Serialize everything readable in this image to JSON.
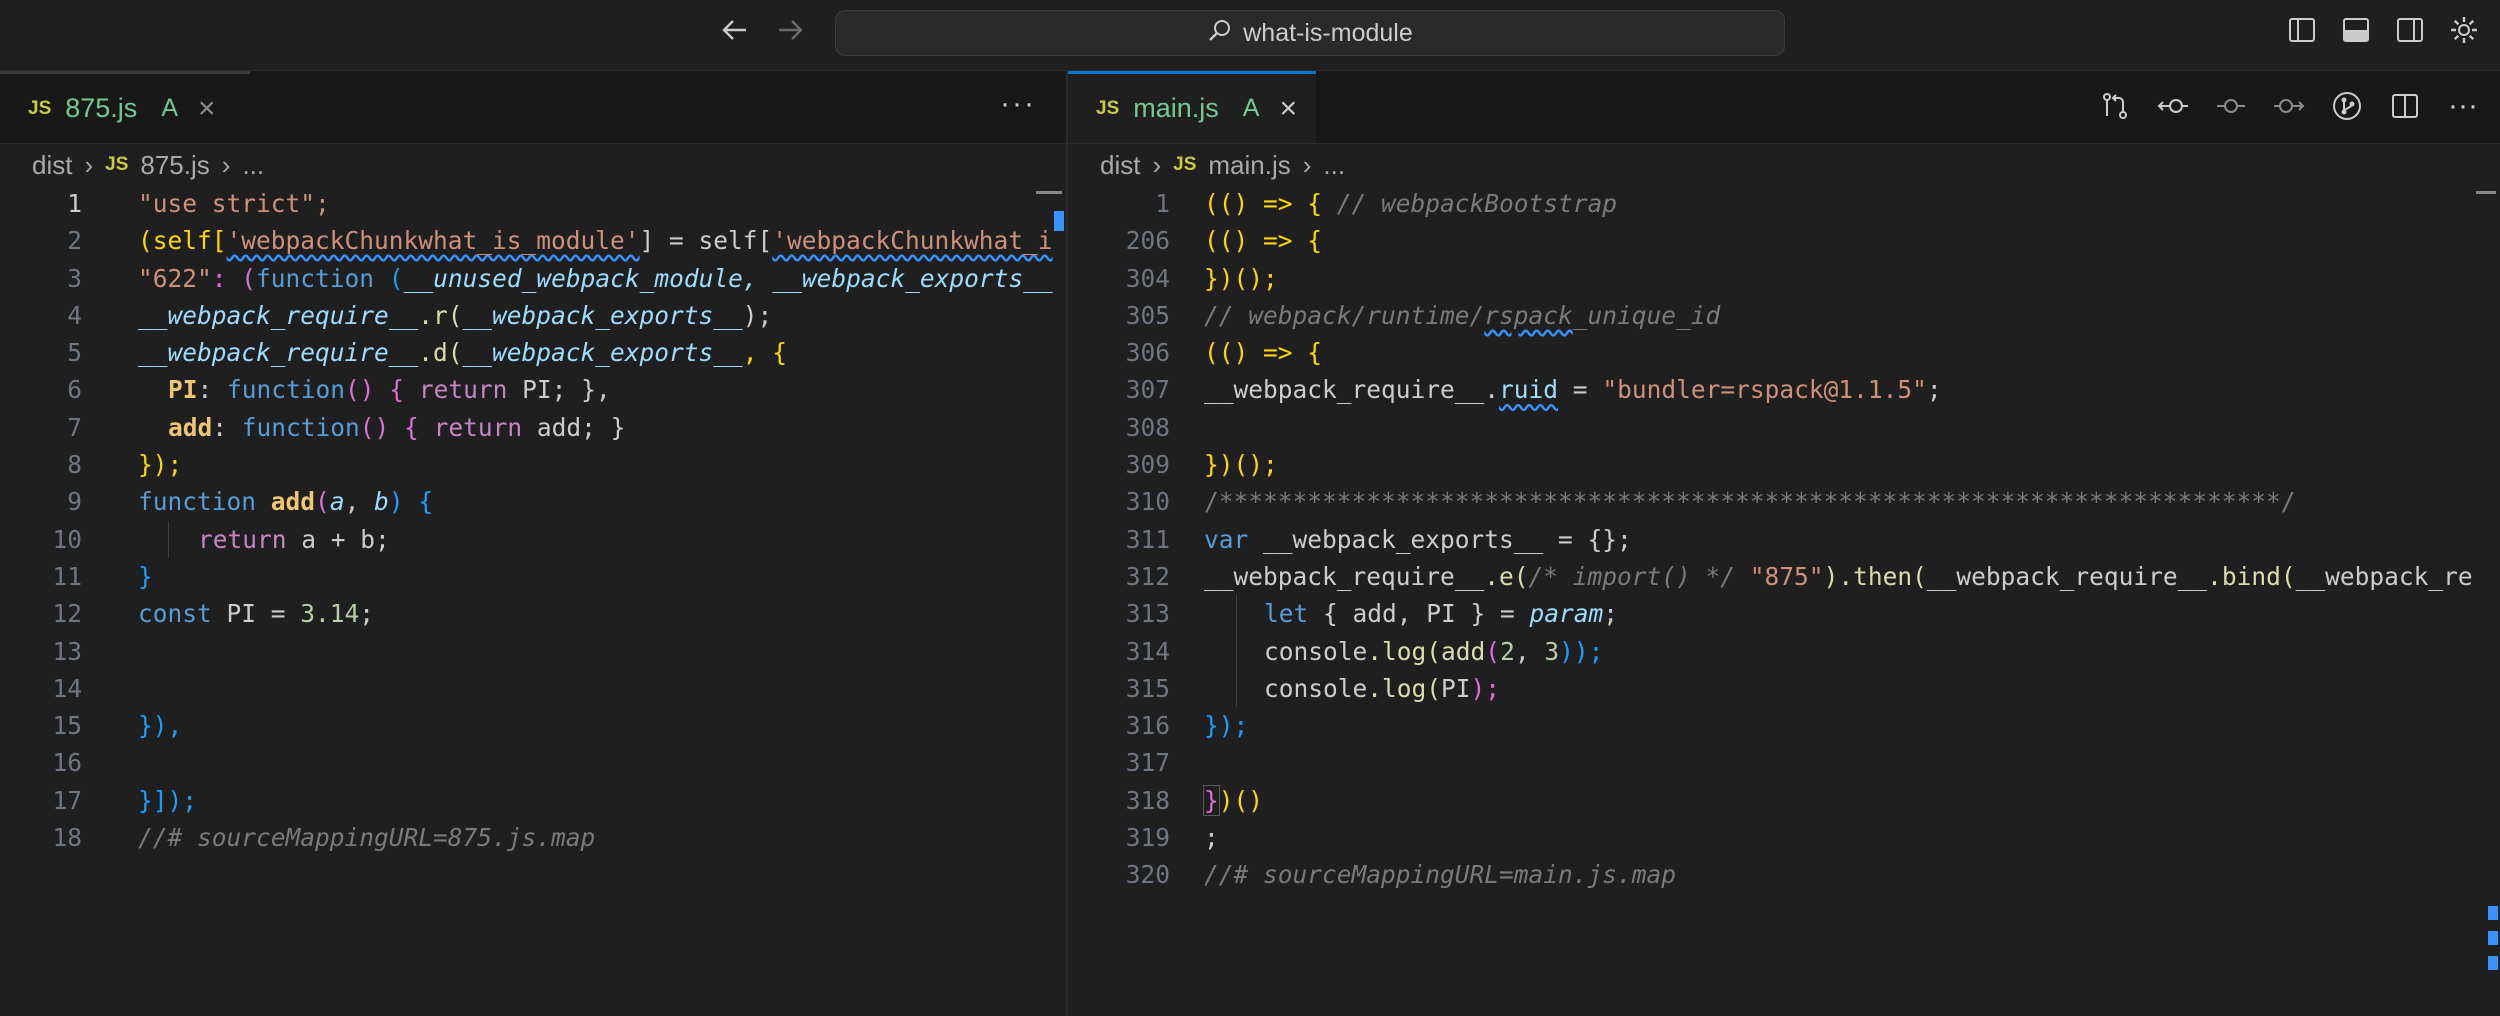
{
  "titlebar": {
    "search_label": "what-is-module",
    "back_icon": "arrow-left-icon",
    "forward_icon": "arrow-right-icon",
    "layout_icons": [
      "toggle-primary-sidebar-icon",
      "toggle-panel-icon",
      "toggle-secondary-sidebar-icon",
      "settings-gear-icon"
    ]
  },
  "left_pane": {
    "tab": {
      "badge": "JS",
      "name": "875.js",
      "status": "A",
      "close": "×"
    },
    "more": "···",
    "breadcrumb": {
      "folder": "dist",
      "badge": "JS",
      "file": "875.js",
      "ellipsis": "..."
    },
    "lines": [
      {
        "n": "1"
      },
      {
        "n": "2"
      },
      {
        "n": "3"
      },
      {
        "n": "4"
      },
      {
        "n": "5"
      },
      {
        "n": "6"
      },
      {
        "n": "7"
      },
      {
        "n": "8"
      },
      {
        "n": "9"
      },
      {
        "n": "10"
      },
      {
        "n": "11"
      },
      {
        "n": "12"
      },
      {
        "n": "13"
      },
      {
        "n": "14"
      },
      {
        "n": "15"
      },
      {
        "n": "16"
      },
      {
        "n": "17"
      },
      {
        "n": "18"
      }
    ],
    "code": {
      "l1": "\"use strict\";",
      "l2a": "(self[",
      "l2b": "'webpackChunkwhat_is_module'",
      "l2c": "] = self[",
      "l2d": "'webpackChunkwhat_i",
      "l3a": "\"622\"",
      "l3b": ": (",
      "l3c": "function",
      "l3d": " (",
      "l3e": "__unused_webpack_module, __webpack_exports__",
      "l4a": "__webpack_require__",
      "l4b": ".r(",
      "l4c": "__webpack_exports__",
      "l4d": ");",
      "l5a": "__webpack_require__",
      "l5b": ".d(",
      "l5c": "__webpack_exports__",
      "l5d": ", {",
      "l6a": "PI",
      "l6b": ": ",
      "l6c": "function",
      "l6d": "() { ",
      "l6e": "return",
      "l6f": " PI; },",
      "l7a": "add",
      "l7b": ": ",
      "l7c": "function",
      "l7d": "() { ",
      "l7e": "return",
      "l7f": " add; }",
      "l8": "});",
      "l9a": "function",
      "l9b": "add",
      "l9c": "(",
      "l9d": "a",
      "l9e": ", ",
      "l9f": "b",
      "l9g": ") {",
      "l10a": "return",
      "l10b": " a + b;",
      "l11": "}",
      "l12a": "const",
      "l12b": " PI = ",
      "l12c": "3.14",
      "l12d": ";",
      "l15": "}),",
      "l17": "}]);",
      "l18": "//# sourceMappingURL=875.js.map"
    }
  },
  "right_pane": {
    "tab": {
      "badge": "JS",
      "name": "main.js",
      "status": "A",
      "close": "×"
    },
    "more": "···",
    "actions": [
      "compare-changes-icon",
      "go-previous-change-icon",
      "go-to-change-icon",
      "go-next-change-icon",
      "open-timeline-icon",
      "split-editor-icon"
    ],
    "breadcrumb": {
      "folder": "dist",
      "badge": "JS",
      "file": "main.js",
      "ellipsis": "..."
    },
    "lines": [
      {
        "n": "1"
      },
      {
        "n": "206"
      },
      {
        "n": "304"
      },
      {
        "n": "305"
      },
      {
        "n": "306"
      },
      {
        "n": "307"
      },
      {
        "n": "308"
      },
      {
        "n": "309"
      },
      {
        "n": "310"
      },
      {
        "n": "311"
      },
      {
        "n": "312"
      },
      {
        "n": "313"
      },
      {
        "n": "314"
      },
      {
        "n": "315"
      },
      {
        "n": "316"
      },
      {
        "n": "317"
      },
      {
        "n": "318"
      },
      {
        "n": "319"
      },
      {
        "n": "320"
      }
    ],
    "code": {
      "r1a": "(() => { ",
      "r1b": "// webpackBootstrap",
      "r2": "(() => {",
      "r3": "})();",
      "r4a": "// webpack/runtime/",
      "r4b": "rspack",
      "r4c": "_unique_id",
      "r5": "(() => {",
      "r6a": "__webpack_require__",
      "r6b": ".",
      "r6c": "ruid",
      "r6d": " = ",
      "r6e": "\"bundler=rspack@1.1.5\"",
      "r6f": ";",
      "r8": "})();",
      "r9": "/************************************************************************/",
      "r10a": "var",
      "r10b": " __webpack_exports__ = {};",
      "r11a": "__webpack_require__",
      "r11b": ".e(",
      "r11c": "/* import() */",
      "r11d": " \"875\"",
      "r11e": ").then(",
      "r11f": "__webpack_require__",
      "r11g": ".bind(",
      "r11h": "__webpack_re",
      "r12a": "let",
      "r12b": " { add, PI } = ",
      "r12c": "param",
      "r12d": ";",
      "r13a": "console",
      "r13b": ".log(",
      "r13c": "add",
      "r13d": "(",
      "r13e": "2",
      "r13f": ", ",
      "r13g": "3",
      "r13h": "));",
      "r14a": "console",
      "r14b": ".log(",
      "r14c": "PI",
      "r14d": ");",
      "r15": "});",
      "r17a": "}",
      "r17b": ")()",
      "r18": ";",
      "r19": "//# sourceMappingURL=main.js.map"
    }
  }
}
